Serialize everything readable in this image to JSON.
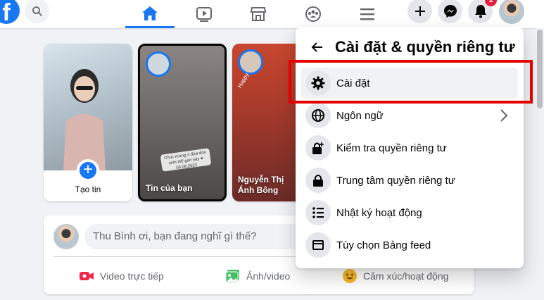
{
  "topbar": {
    "logo_letter": "f",
    "nav": [
      {
        "name": "home",
        "active": true
      },
      {
        "name": "watch",
        "active": false
      },
      {
        "name": "marketplace",
        "active": false
      },
      {
        "name": "groups",
        "active": false
      },
      {
        "name": "menu",
        "active": false
      }
    ],
    "notification_count": "1"
  },
  "stories": {
    "create_label": "Tạo tin",
    "yours_label": "Tin của bạn",
    "yours_note": "Chúc mừng 4 đứa đón sinh thể giới này ♥ 05.08.2022",
    "friend_label": "Nguyễn Thị Ánh Bông",
    "friend_caption": "Happy"
  },
  "composer": {
    "placeholder": "Thu Bình ơi, bạn đang nghĩ gì thế?",
    "actions": [
      {
        "label": "Video trực tiếp",
        "icon": "live-video-icon",
        "color": "#f02849"
      },
      {
        "label": "Ảnh/video",
        "icon": "photo-icon",
        "color": "#45bd62"
      },
      {
        "label": "Cảm xúc/hoạt động",
        "icon": "feeling-icon",
        "color": "#f7b928"
      }
    ]
  },
  "menu": {
    "title": "Cài đặt & quyền riêng tư",
    "items": [
      {
        "label": "Cài đặt",
        "icon": "gear-icon",
        "highlighted": true
      },
      {
        "label": "Ngôn ngữ",
        "icon": "globe-icon",
        "has_submenu": true
      },
      {
        "label": "Kiểm tra quyền riêng tư",
        "icon": "lock-check-icon"
      },
      {
        "label": "Trung tâm quyền riêng tư",
        "icon": "lock-icon"
      },
      {
        "label": "Nhật ký hoạt động",
        "icon": "list-icon"
      },
      {
        "label": "Tùy chọn Bảng feed",
        "icon": "feed-icon"
      }
    ]
  },
  "colors": {
    "brand": "#1877f2",
    "highlight_box": "#e40000"
  }
}
